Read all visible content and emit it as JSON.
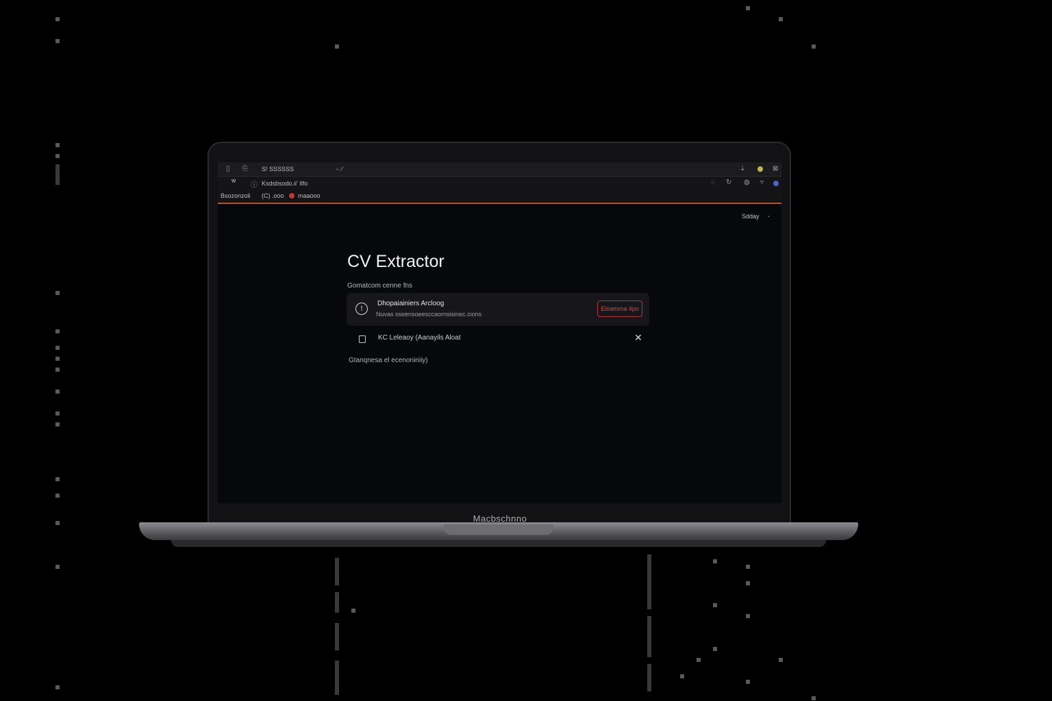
{
  "browser": {
    "tab_title": "S! SSSSSS",
    "tab_glyph": "⌁ ⁄⁄",
    "address": "Ksdsbsodo.ii' Ilfo",
    "bookmarks": [
      {
        "label": "Bsozonzoli"
      },
      {
        "label": "(C) .ooo"
      },
      {
        "label": "maaooo"
      }
    ]
  },
  "page": {
    "language": "Sdday",
    "title": "CV Extractor",
    "subtitle": "Gomatcom cenne fns",
    "notice": {
      "title": "Dhopaiainiers Arcloog",
      "subtitle": "Nuvas sseensoeesccaornsisinec.cions",
      "button_label": "Eloamma 4po"
    },
    "checkbox_label": "KC Leleaoy (Aanayils  Aloat",
    "footnote": "Gtanqnesa el ecenoniniiy)"
  },
  "device": {
    "label": "Macbschnno"
  },
  "colors": {
    "accent_orange": "#b3532f",
    "button_red": "#cf4a4e",
    "screen_bg": "#07080b"
  }
}
